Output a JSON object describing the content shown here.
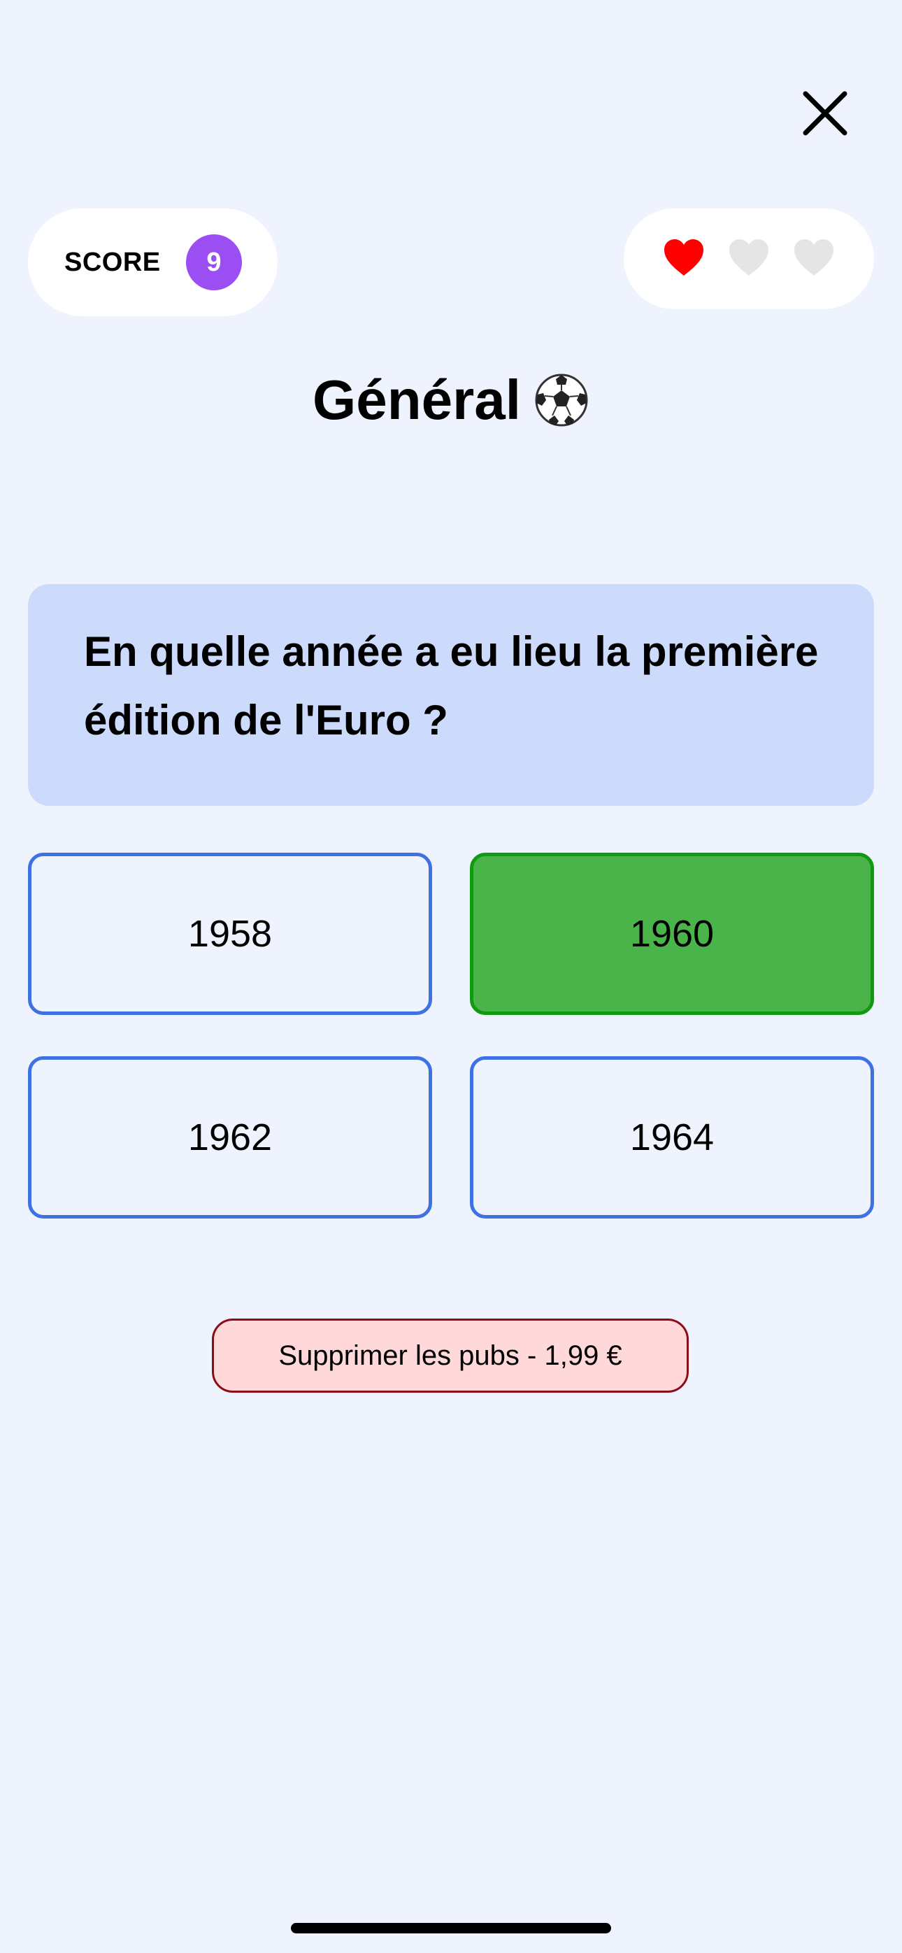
{
  "header": {
    "close_icon": "close-icon"
  },
  "score": {
    "label": "SCORE",
    "value": "9",
    "badge_color": "#9b4ff2"
  },
  "lives": {
    "total": 3,
    "remaining": 1,
    "full_color": "#ff0000",
    "empty_color": "#e5e5e5"
  },
  "category": {
    "title": "Général",
    "icon": "soccer-ball-icon"
  },
  "question": {
    "text": "En quelle année a eu lieu la première édition de l'Euro ?"
  },
  "answers": [
    {
      "label": "1958",
      "state": "default"
    },
    {
      "label": "1960",
      "state": "correct"
    },
    {
      "label": "1962",
      "state": "default"
    },
    {
      "label": "1964",
      "state": "default"
    }
  ],
  "ads": {
    "remove_label": "Supprimer les pubs - 1,99 €"
  },
  "colors": {
    "background": "#eff3fe",
    "question_bg": "#ccdafc",
    "answer_border": "#3e71e2",
    "correct_bg": "#4ab34a",
    "ads_bg": "#ffd8d9",
    "ads_border": "#8b0b18"
  }
}
